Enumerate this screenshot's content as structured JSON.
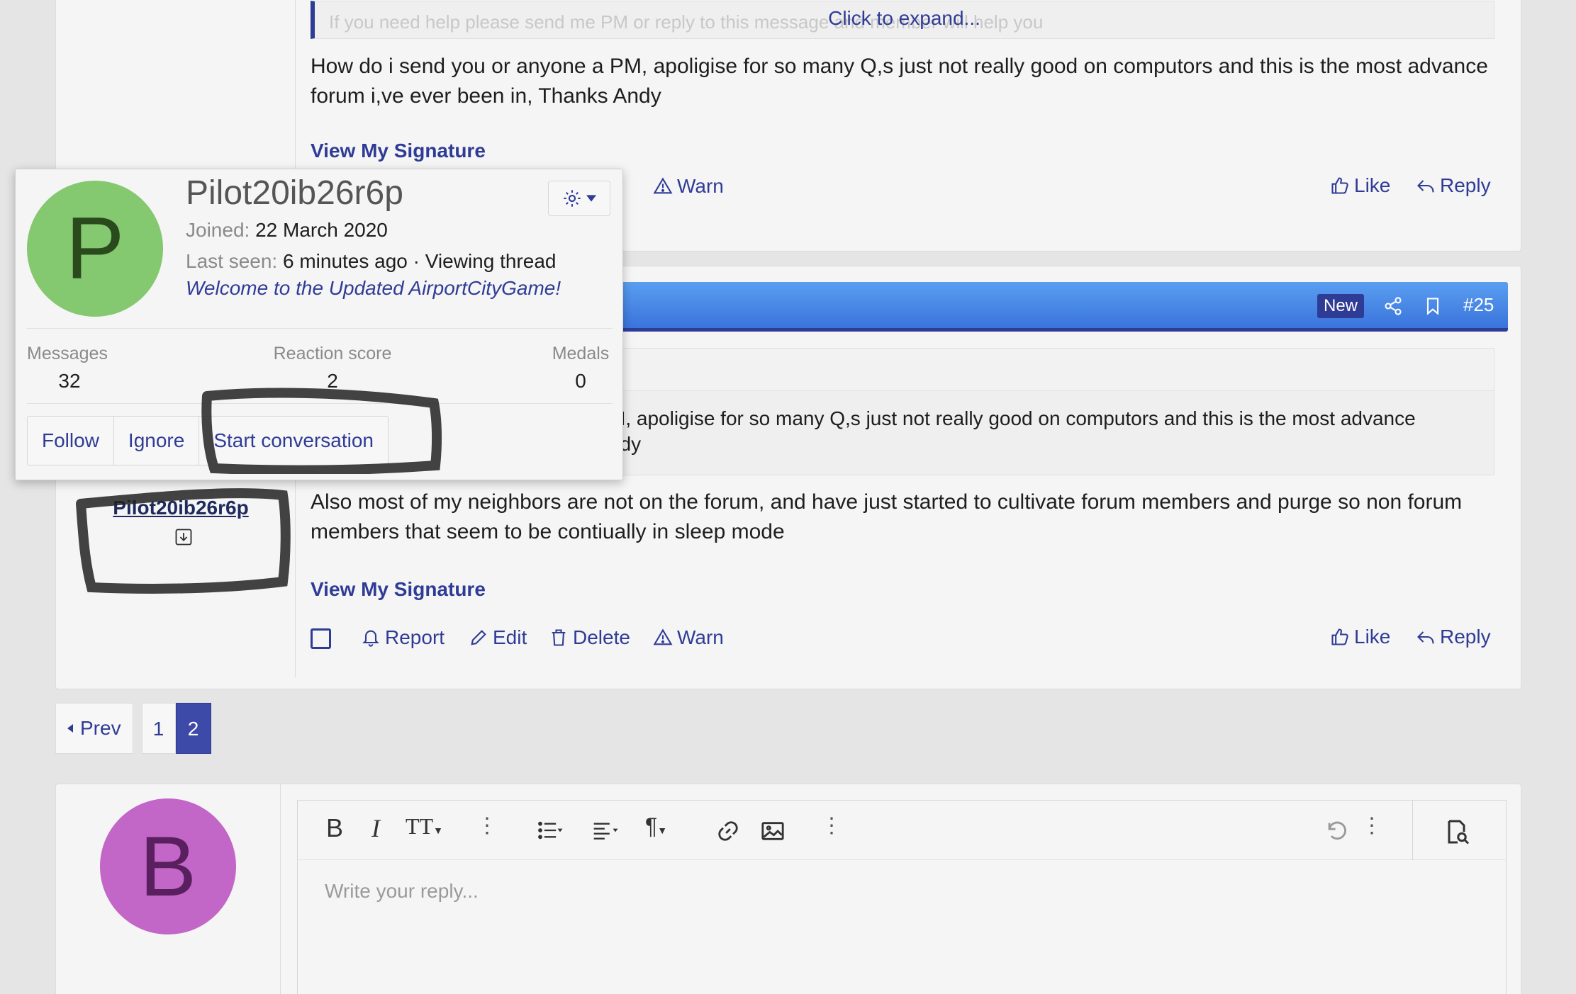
{
  "post1": {
    "expand_label": "Click to expand...",
    "faded_quote": "If you need help please send me PM or reply to this message and member will help you",
    "body": "How do i send you or anyone a PM, apoligise for so many Q,s just not really good on computors and this is the most advance forum i,ve ever been in, Thanks Andy",
    "signature_label": "View My Signature",
    "partial_action": "e",
    "warn": "Warn",
    "like": "Like",
    "reply": "Reply"
  },
  "post2": {
    "new_badge": "New",
    "post_number": "#25",
    "quote_text_line1": "M, apoligise for so many Q,s just not really good on computors and this is the most advance",
    "quote_text_line2": "ndy",
    "body": "Also most of my neighbors are not on the forum, and have just started to cultivate forum members and purge so non forum members that seem to be contiually in sleep mode",
    "signature_label": "View My Signature",
    "author": "Pilot20ib26r6p",
    "report": "Report",
    "edit": "Edit",
    "delete": "Delete",
    "warn": "Warn",
    "like": "Like",
    "reply": "Reply"
  },
  "popup": {
    "avatar_letter": "P",
    "avatar_color": "#84c86f",
    "username": "Pilot20ib26r6p",
    "joined_label": "Joined:",
    "joined_value": "22 March 2020",
    "lastseen_label": "Last seen:",
    "lastseen_value": "6 minutes ago · Viewing thread",
    "custom_title": "Welcome to the Updated AirportCityGame!",
    "stats": [
      {
        "label": "Messages",
        "value": "32"
      },
      {
        "label": "Reaction score",
        "value": "2"
      },
      {
        "label": "Medals",
        "value": "0"
      }
    ],
    "follow": "Follow",
    "ignore": "Ignore",
    "start_conversation": "Start conversation"
  },
  "pagination": {
    "prev": "Prev",
    "pages": [
      "1",
      "2"
    ],
    "current": "2"
  },
  "reply_box": {
    "avatar_letter": "B",
    "avatar_color": "#c266c8",
    "placeholder": "Write your reply..."
  },
  "colors": {
    "accent": "#2f3c96",
    "header_blue": "#3d7be0",
    "badge_new": "#3344aa"
  }
}
